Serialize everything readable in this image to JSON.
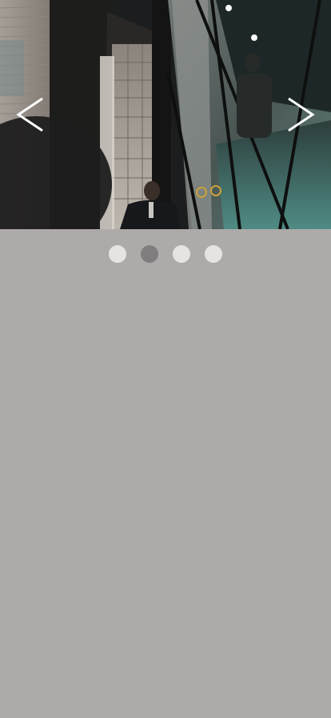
{
  "carousel": {
    "slides": [
      "slide-1",
      "slide-2",
      "slide-3",
      "slide-4"
    ],
    "active_index": 1,
    "prev_icon": "chevron-left-icon",
    "next_icon": "chevron-right-icon"
  },
  "colors": {
    "page_background": "#aeaaa9",
    "dot_inactive": "#e6e4e3",
    "dot_active": "#7f7d7d",
    "arrow": "#ffffff"
  }
}
